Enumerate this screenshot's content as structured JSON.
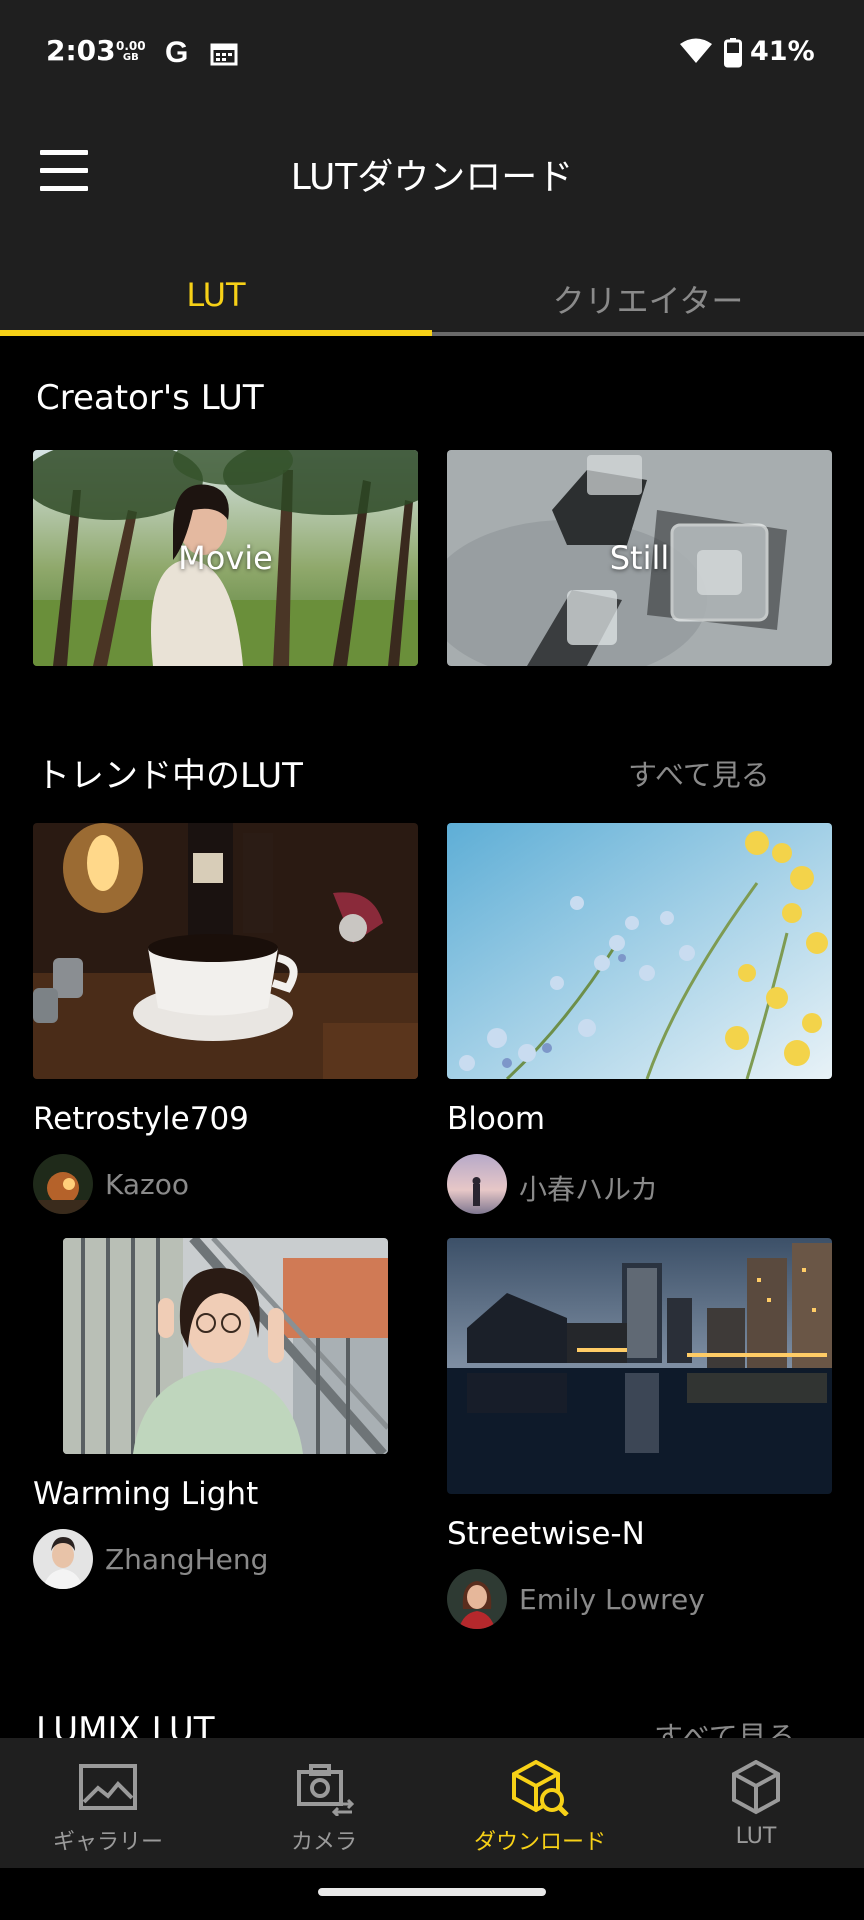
{
  "status_bar": {
    "time": "2:03",
    "data_value": "0.00",
    "data_unit": "GB",
    "google_glyph": "G",
    "battery_percent": "41%",
    "icons": [
      "google-icon",
      "calendar-icon",
      "wifi-icon",
      "battery-icon"
    ]
  },
  "app_bar": {
    "title": "LUTダウンロード",
    "menu_icon": "hamburger-menu-icon"
  },
  "tabs": [
    {
      "label": "LUT",
      "active": true
    },
    {
      "label": "クリエイター",
      "active": false
    }
  ],
  "creators_section": {
    "title": "Creator's LUT",
    "cards": [
      {
        "label": "Movie"
      },
      {
        "label": "Still"
      }
    ]
  },
  "trending_section": {
    "title": "トレンド中のLUT",
    "see_all": "すべて見る",
    "items": [
      {
        "name": "Retrostyle709",
        "author": "Kazoo"
      },
      {
        "name": "Bloom",
        "author": "小春ハルカ"
      },
      {
        "name": "Warming Light",
        "author": "ZhangHeng"
      },
      {
        "name": "Streetwise-N",
        "author": "Emily Lowrey"
      }
    ]
  },
  "lumix_section": {
    "title": "LUMIX LUT",
    "see_all": "すべて見る"
  },
  "bottom_nav": [
    {
      "label": "ギャラリー",
      "icon": "gallery-icon",
      "active": false
    },
    {
      "label": "カメラ",
      "icon": "camera-icon",
      "active": false
    },
    {
      "label": "ダウンロード",
      "icon": "lut-download-icon",
      "active": true
    },
    {
      "label": "LUT",
      "icon": "lut-cube-icon",
      "active": false
    }
  ],
  "colors": {
    "accent": "#f7d117",
    "bar_background": "#1f1f1f",
    "content_background": "#000000",
    "secondary_text": "#8a8a8a"
  }
}
